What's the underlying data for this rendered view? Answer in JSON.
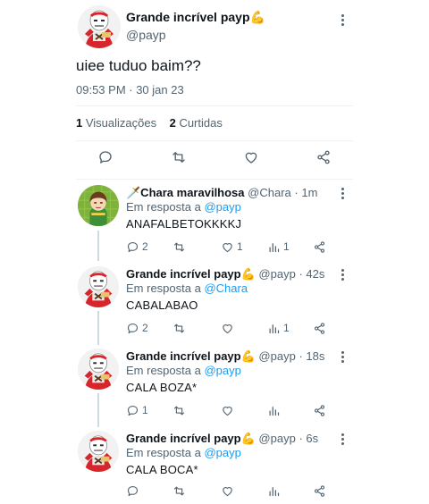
{
  "tweet": {
    "author_name": "Grande incrível payp💪",
    "author_handle": "@payp",
    "text": "uiee tuduo baim??",
    "timestamp": "09:53 PM · 30 jan 23",
    "views_count": "1",
    "views_label": "Visualizações",
    "likes_count": "2",
    "likes_label": "Curtidas"
  },
  "replies": [
    {
      "name": "🗡️Chara maravilhosa",
      "handle": "@Chara",
      "time": "1m",
      "reply_prefix": "Em resposta a",
      "reply_to": "@payp",
      "text": "ANAFALBETOKKKKJ",
      "reply_count": "2",
      "retweet_count": "",
      "like_count": "1",
      "view_count": "1"
    },
    {
      "name": "Grande incrível payp💪",
      "handle": "@payp",
      "time": "42s",
      "reply_prefix": "Em resposta a",
      "reply_to": "@Chara",
      "text": "CABALABAO",
      "reply_count": "2",
      "retweet_count": "",
      "like_count": "",
      "view_count": "1"
    },
    {
      "name": "Grande incrível payp💪",
      "handle": "@payp",
      "time": "18s",
      "reply_prefix": "Em resposta a",
      "reply_to": "@payp",
      "text": "CALA BOZA*",
      "reply_count": "1",
      "retweet_count": "",
      "like_count": "",
      "view_count": ""
    },
    {
      "name": "Grande incrível payp💪",
      "handle": "@payp",
      "time": "6s",
      "reply_prefix": "Em resposta a",
      "reply_to": "@payp",
      "text": "CALA BOCA*",
      "reply_count": "",
      "retweet_count": "",
      "like_count": "",
      "view_count": ""
    }
  ],
  "colors": {
    "accent": "#1d9bf0",
    "muted": "#536471",
    "text": "#0f1419",
    "divider": "#eff3f4"
  }
}
